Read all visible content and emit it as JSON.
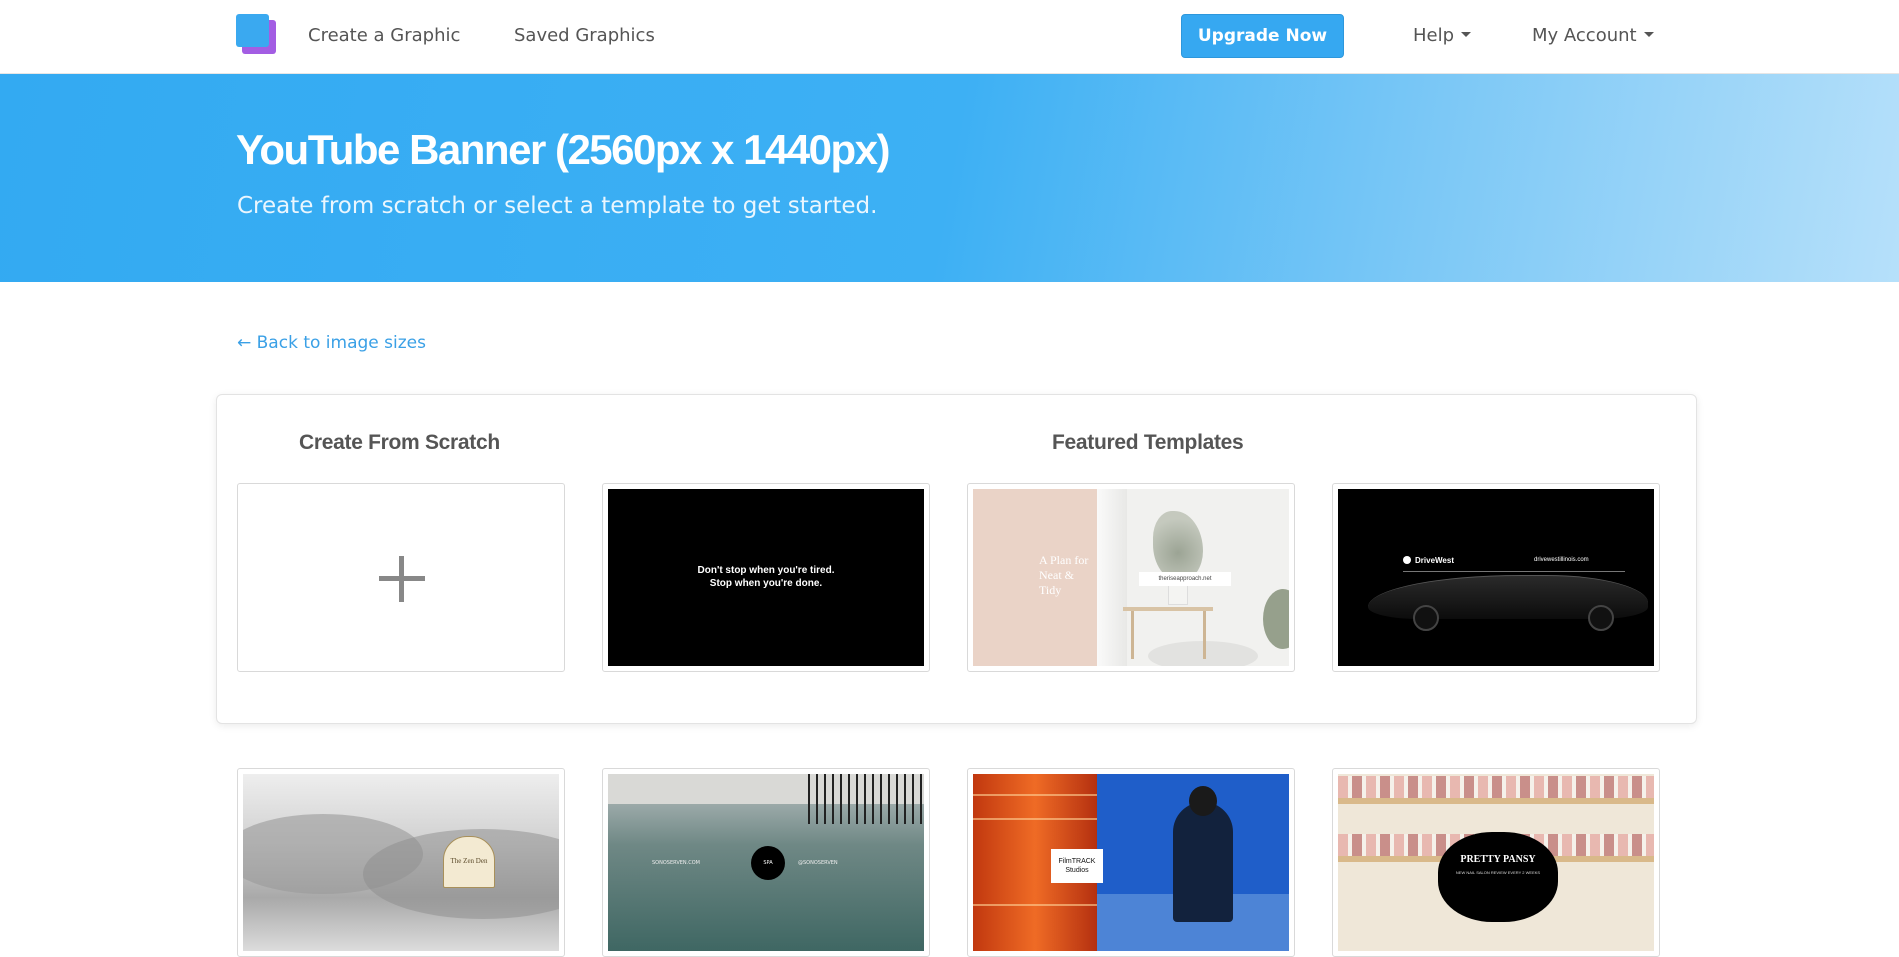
{
  "nav": {
    "create_label": "Create a Graphic",
    "saved_label": "Saved Graphics",
    "upgrade_label": "Upgrade Now",
    "help_label": "Help",
    "account_label": "My Account"
  },
  "hero": {
    "title": "YouTube Banner (2560px x 1440px)",
    "subtitle": "Create from scratch or select a template to get started."
  },
  "back_link": "← Back to image sizes",
  "sections": {
    "scratch_title": "Create From Scratch",
    "featured_title": "Featured Templates"
  },
  "templates": {
    "t1_quote_line1": "Don't stop when you're tired.",
    "t1_quote_line2": "Stop when you're done.",
    "t2_text": "A Plan for Neat & Tidy",
    "t2_label": "theriseapproach.net",
    "t3_brand": "DriveWest",
    "t3_site": "drivewestillinois.com",
    "t4_badge": "The Zen Den",
    "t5_center": "SPA",
    "t5_left": "SONOSERVEN.COM",
    "t5_right": "@SONOSERVEN",
    "t6_card": "FilmTRACK Studios",
    "t7_title": "PRETTY PANSY",
    "t7_sub": "NEW NAIL SALON REVIEW EVERY 2 WEEKS"
  },
  "colors": {
    "accent": "#36a8f1",
    "logo_front": "#3aa9f0",
    "logo_back": "#a35de3",
    "link": "#3aa0e6"
  }
}
